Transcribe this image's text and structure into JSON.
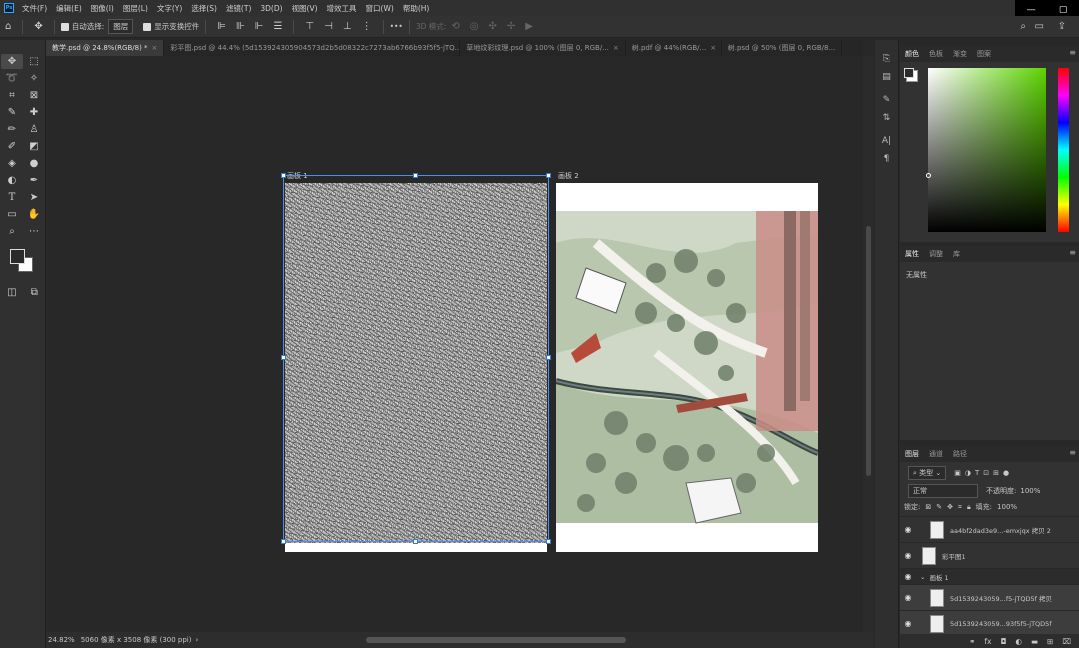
{
  "app": {
    "logo": "Ps",
    "win_min": "—",
    "win_max": "▢"
  },
  "menu": [
    "文件(F)",
    "编辑(E)",
    "图像(I)",
    "图层(L)",
    "文字(Y)",
    "选择(S)",
    "滤镜(T)",
    "3D(D)",
    "视图(V)",
    "增效工具",
    "窗口(W)",
    "帮助(H)"
  ],
  "options": {
    "auto_select": "自动选择:",
    "auto_select_target": "图层",
    "show_transform": "显示变换控件",
    "mode3d": "3D 模式:",
    "more": "•••"
  },
  "tabs": [
    {
      "label": "教学.psd @ 24.8%(RGB/8) *",
      "active": true
    },
    {
      "label": "彩平图.psd @ 44.4% (5d153924305904573d2b5d08322c7273ab6766b93f5f5-jTQ...",
      "active": false
    },
    {
      "label": "草地纹彩纹理.psd @ 100% (图层 0, RGB/...",
      "active": false
    },
    {
      "label": "树.pdf @ 44%(RGB/...",
      "active": false
    },
    {
      "label": "树.psd @ 50% (图层 0, RGB/8...",
      "active": false
    }
  ],
  "canvas": {
    "artboard1": "画板 1",
    "artboard2": "画板 2"
  },
  "status": {
    "zoom": "24.82%",
    "doc_info": "5060 像素 x 3508 像素 (300 ppi)",
    "arrow": "›"
  },
  "color_panel": {
    "tabs": [
      "颜色",
      "色板",
      "渐变",
      "图案"
    ],
    "menu": "≡"
  },
  "properties_panel": {
    "tabs": [
      "属性",
      "调整",
      "库"
    ],
    "empty": "无属性",
    "menu": "≡"
  },
  "layers_panel": {
    "tabs": [
      "图层",
      "通道",
      "路径"
    ],
    "menu": "≡",
    "filter_kind": "类型",
    "blend_mode": "正常",
    "opacity_label": "不透明度:",
    "opacity": "100%",
    "lock_label": "锁定:",
    "fill_label": "填充:",
    "fill": "100%",
    "rows": [
      {
        "name": "aa4bf2dad3e9...-emxjqx 拷贝 2",
        "group": false,
        "indent": true
      },
      {
        "name": "彩平图1",
        "group": false,
        "indent": false
      },
      {
        "name": "画板 1",
        "group": true,
        "indent": false
      },
      {
        "name": "5d1539243059...f5-jTQD5f 拷贝",
        "group": false,
        "indent": true
      },
      {
        "name": "5d1539243059...93f5f5-jTQD5f",
        "group": false,
        "indent": true
      }
    ],
    "footer_icons": [
      "link-icon",
      "fx-icon",
      "mask-icon",
      "adjustment-icon",
      "folder-icon",
      "new-layer-icon",
      "trash-icon"
    ]
  },
  "tools": [
    "move",
    "marquee",
    "lasso",
    "magic-wand",
    "crop",
    "frame",
    "eyedropper",
    "healing",
    "brush",
    "stamp",
    "history-brush",
    "eraser",
    "bucket",
    "blur",
    "dodge",
    "pen",
    "type",
    "path-select",
    "rectangle",
    "hand",
    "zoom",
    "more"
  ]
}
